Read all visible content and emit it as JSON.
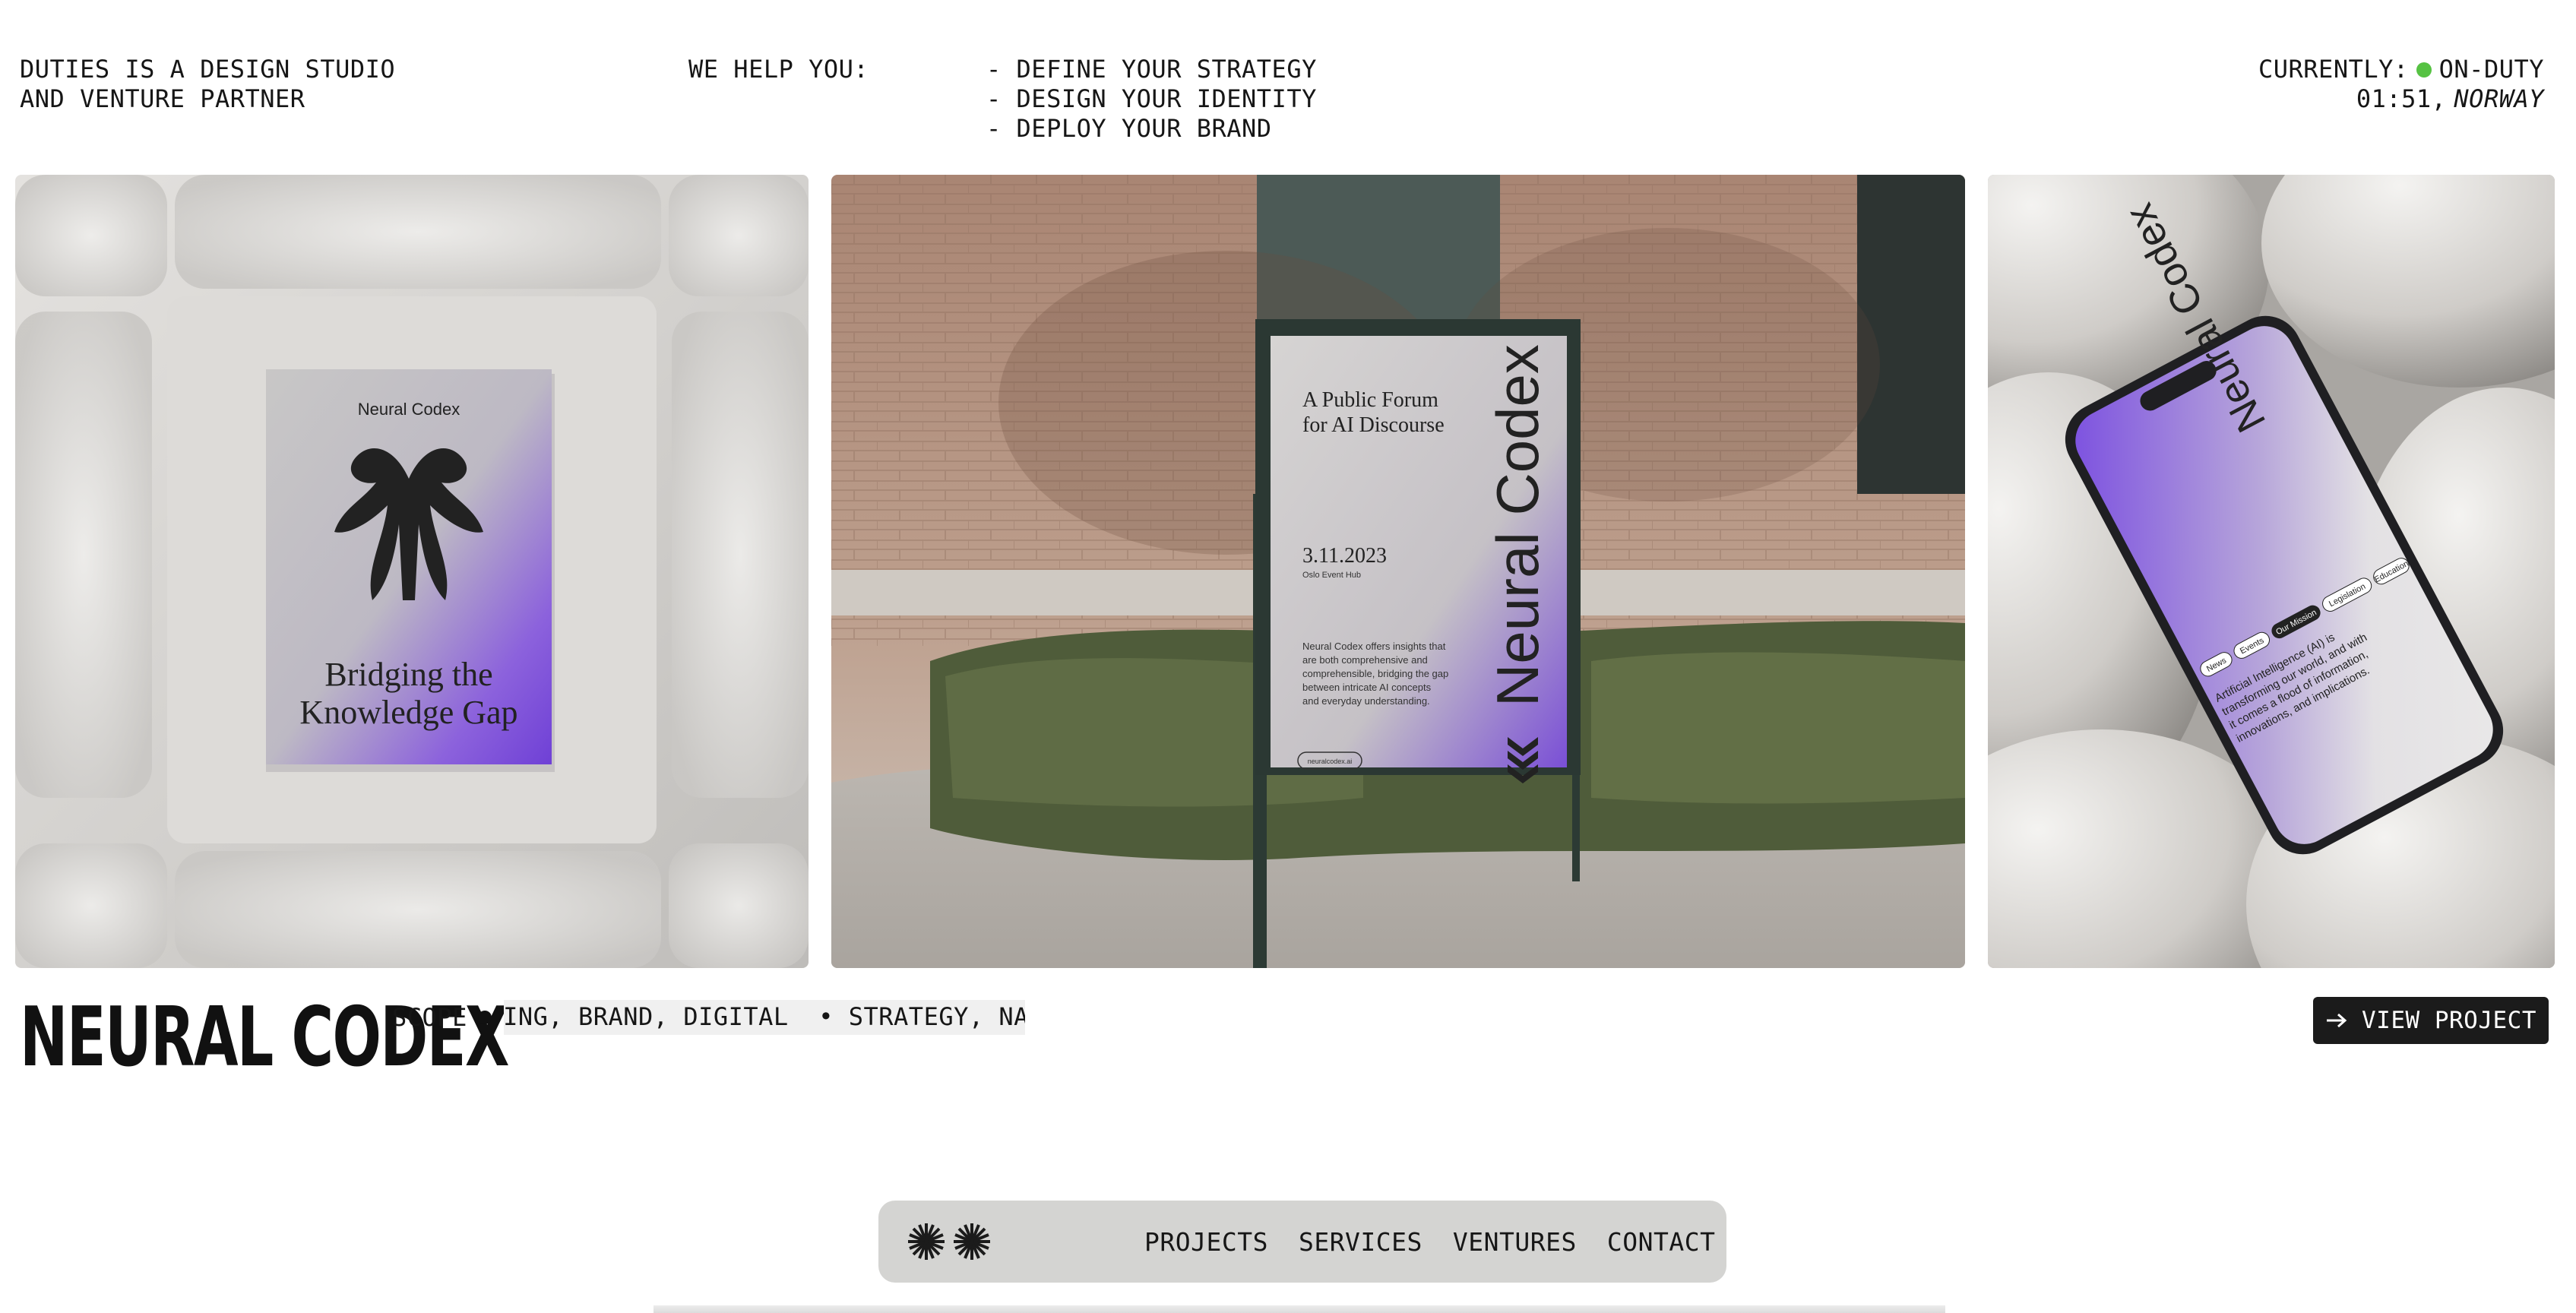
{
  "header": {
    "tagline_line1": "DUTIES IS A DESIGN STUDIO",
    "tagline_line2": "AND VENTURE PARTNER",
    "help_label": "WE HELP YOU:",
    "services": [
      "- DEFINE YOUR STRATEGY",
      "- DESIGN YOUR IDENTITY",
      "- DEPLOY YOUR BRAND"
    ],
    "status_label": "CURRENTLY:",
    "status_value": "ON-DUTY",
    "status_color": "#56c243",
    "time": "01:51,",
    "location": "NORWAY"
  },
  "gallery": {
    "book": {
      "brand": "Neural Codex",
      "title_line1": "Bridging the",
      "title_line2": "Knowledge Gap"
    },
    "poster": {
      "heading_line1": "A Public Forum",
      "heading_line2": "for AI Discourse",
      "date": "3.11.2023",
      "venue": "Oslo Event Hub",
      "body": [
        "Neural Codex offers insights that",
        "are both comprehensive and",
        "comprehensible, bridging the gap",
        "between intricate AI concepts",
        "and everyday understanding."
      ],
      "brand": "Neural Codex",
      "url": "neuralcodex.ai"
    },
    "phone": {
      "brand": "Neural Codex",
      "tabs": [
        "News",
        "Events",
        "Our Mission",
        "Legislation",
        "Education"
      ],
      "body": [
        "Artificial Intelligence (AI) is",
        "transforming our world, and with",
        "it comes a flood of information,",
        "innovations, and implications."
      ]
    }
  },
  "project": {
    "title": "NEURAL CODEX",
    "scope_label": "SCOPE",
    "scope_text": "NAMING, BRAND, DIGITAL  • STRATEGY, NAMING",
    "view_label": "VIEW PROJECT",
    "view_icon": "arrow-right-icon"
  },
  "nav": {
    "logo_icon": "double-starburst-icon",
    "links": [
      "PROJECTS",
      "SERVICES",
      "VENTURES",
      "CONTACT"
    ]
  },
  "colors": {
    "accent_purple": "#7247d8",
    "nav_bg": "#d4d4d2",
    "button_bg": "#1b1b1b"
  }
}
